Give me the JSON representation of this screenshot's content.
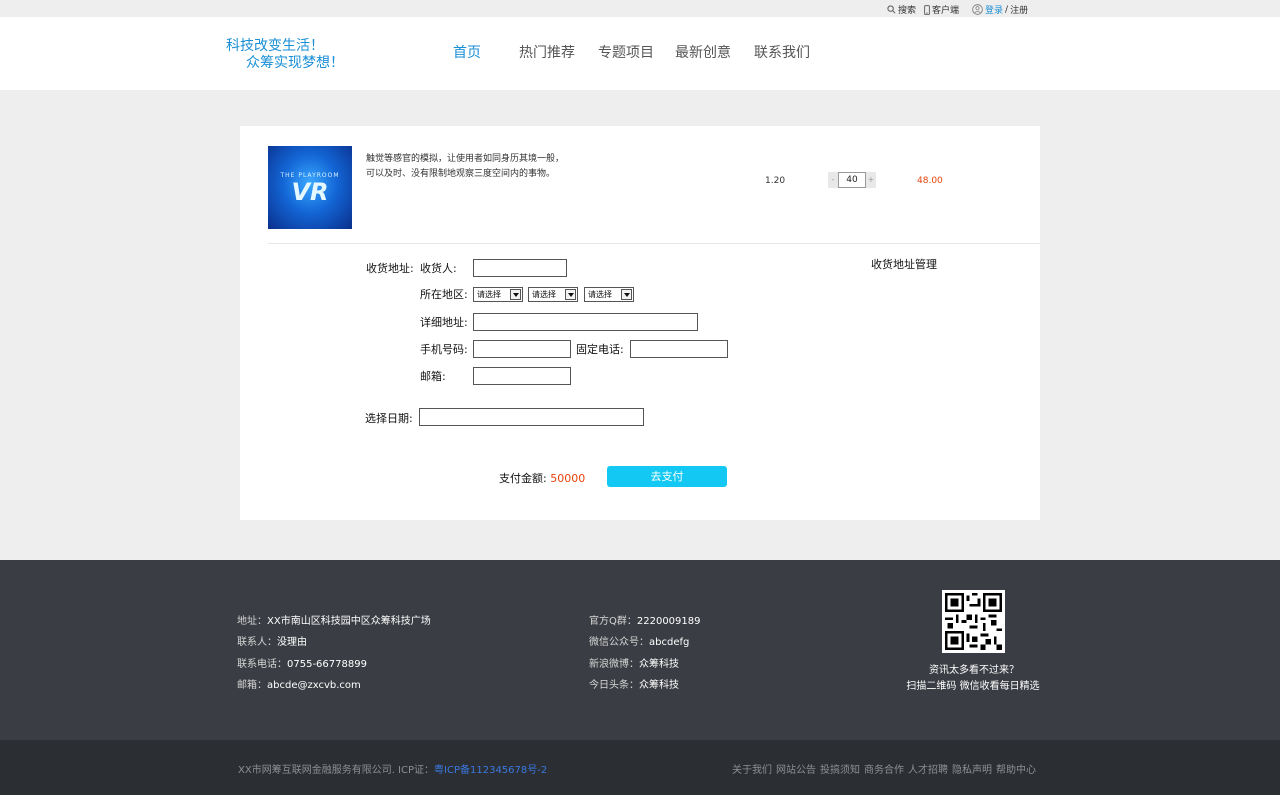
{
  "topbar": {
    "search": "搜索",
    "client": "客户端",
    "login": "登录",
    "separator": "/",
    "register": "注册"
  },
  "header": {
    "slogan_line1": "科技改变生活！",
    "slogan_line2": "众筹实现梦想！",
    "nav": [
      "首页",
      "热门推荐",
      "专题项目",
      "最新创意",
      "联系我们"
    ],
    "active_nav": "首页"
  },
  "product": {
    "image_brand": "THE PLAYROOM",
    "image_logo": "VR",
    "description_line1": "触觉等感官的模拟，让使用者如同身历其境一般，",
    "description_line2": "可以及时、没有限制地观察三度空间内的事物。",
    "price": "1.20",
    "qty_minus": "-",
    "qty_plus": "+",
    "quantity": "40",
    "subtotal": "48.00"
  },
  "form": {
    "address_label": "收货地址:",
    "receiver_label": "收货人:",
    "region_label": "所在地区:",
    "region_selects": [
      "请选择",
      "请选择",
      "请选择"
    ],
    "detail_label": "详细地址:",
    "mobile_label": "手机号码:",
    "landline_label": "固定电话:",
    "email_label": "邮箱:",
    "date_label": "选择日期:",
    "address_manage": "收货地址管理"
  },
  "payment": {
    "label": "支付金额:",
    "amount": "50000",
    "button": "去支付"
  },
  "footer": {
    "address_label": "地址：",
    "address": "XX市南山区科技园中区众筹科技广场",
    "contact_label": "联系人：",
    "contact": "没理由",
    "phone_label": "联系电话：",
    "phone": "0755-66778899",
    "email_label": "邮箱：",
    "email": "abcde@zxcvb.com",
    "qq_label": "官方Q群：",
    "qq": "2220009189",
    "wechat_label": "微信公众号：",
    "wechat": "abcdefg",
    "weibo_label": "新浪微博：",
    "weibo": "众筹科技",
    "toutiao_label": "今日头条：",
    "toutiao": "众筹科技",
    "qr_line1": "资讯太多看不过来？",
    "qr_line2": "扫描二维码 微信收看每日精选"
  },
  "copyright": {
    "company": "XX市网筹互联网金融服务有限公司. ICP证：",
    "icp": "粤ICP备112345678号-2",
    "links": [
      "关于我们",
      "网站公告",
      "投搞须知",
      "商务合作",
      "人才招聘",
      "隐私声明",
      "帮助中心"
    ]
  },
  "colors": {
    "accent": "#1a8fd6",
    "pay_button": "#13c8f2",
    "price_red": "#e8430c",
    "footer_bg": "#3a3d43",
    "copyright_bg": "#2b2e33"
  }
}
